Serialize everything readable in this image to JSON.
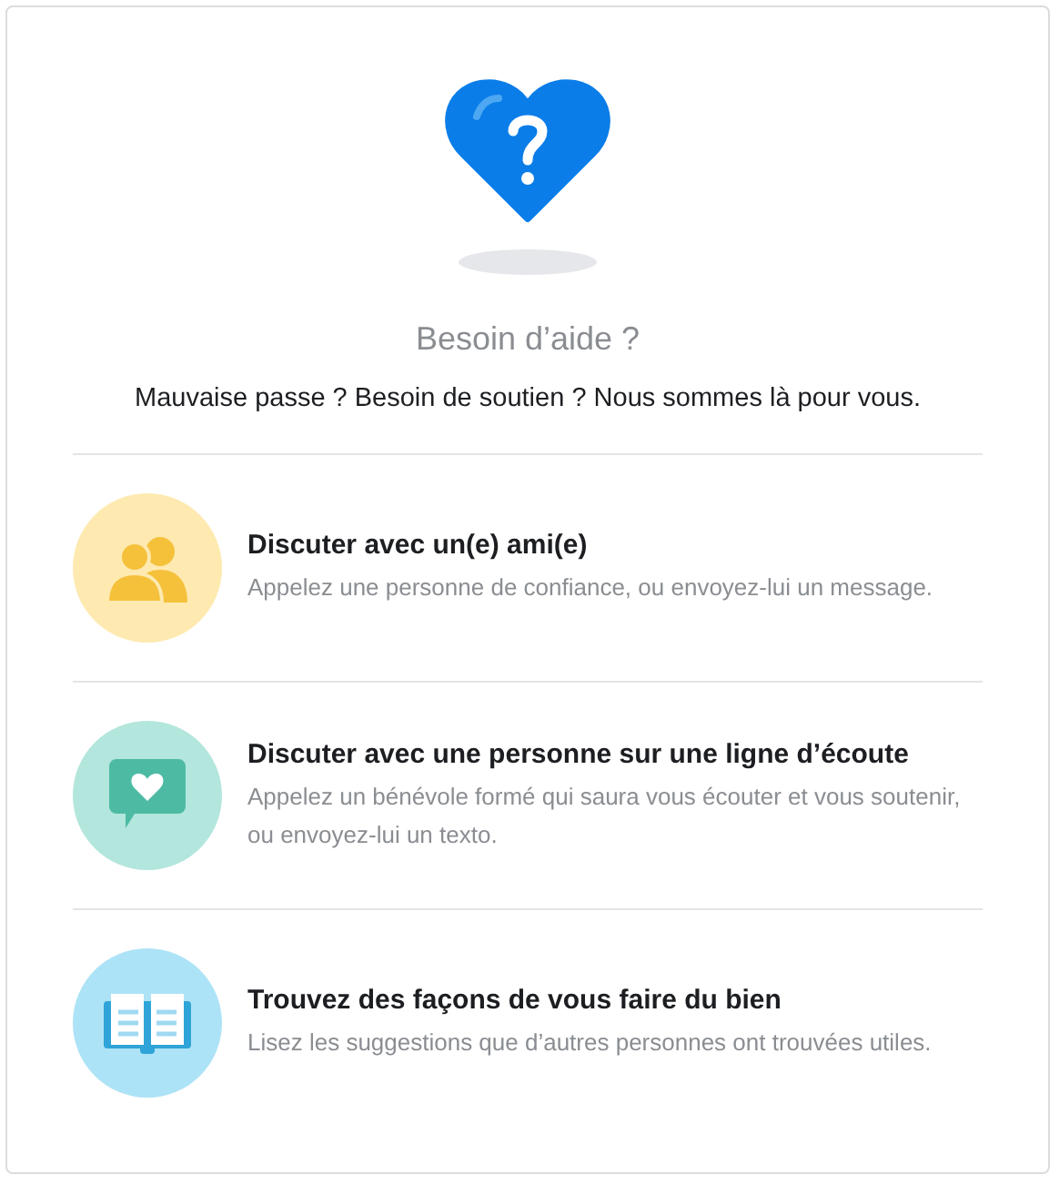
{
  "title": "Besoin d’aide ?",
  "subtitle": "Mauvaise passe ? Besoin de soutien ? Nous sommes là pour vous.",
  "options": [
    {
      "kind": "friends",
      "title": "Discuter avec un(e) ami(e)",
      "description": "Appelez une personne de confiance, ou envoyez-lui un message."
    },
    {
      "kind": "chat",
      "title": "Discuter avec une personne sur une ligne d’écoute",
      "description": "Appelez un bénévole formé qui saura vous écouter et vous soutenir, ou envoyez-lui un texto."
    },
    {
      "kind": "book",
      "title": "Trouvez des façons de vous faire du bien",
      "description": "Lisez les suggestions que d’autres personnes ont trouvées utiles."
    }
  ]
}
